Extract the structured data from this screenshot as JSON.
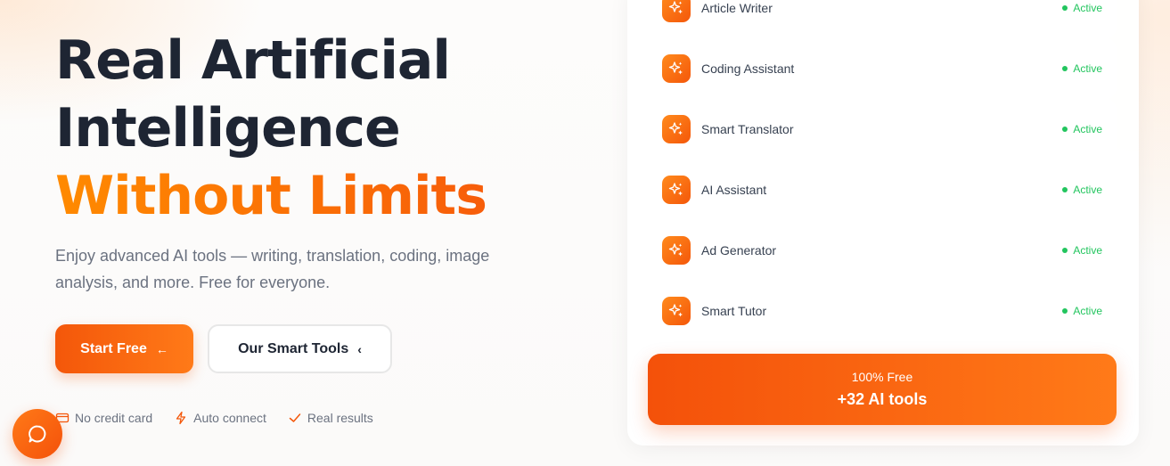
{
  "hero": {
    "title_line1": "Real Artificial",
    "title_line2": "Intelligence",
    "title_accent": "Without Limits",
    "subtitle": "Enjoy advanced AI tools — writing, translation, coding, image analysis, and more. Free for everyone."
  },
  "buttons": {
    "start_label": "Start Free",
    "start_arrow": "←",
    "tools_label": "Our Smart Tools",
    "tools_arrow": "‹"
  },
  "features": [
    {
      "label": "No credit card",
      "icon": "credit-card-icon"
    },
    {
      "label": "Auto connect",
      "icon": "lightning-icon"
    },
    {
      "label": "Real results",
      "icon": "check-icon"
    }
  ],
  "tools": [
    {
      "name": "Article Writer",
      "status": "Active"
    },
    {
      "name": "Coding Assistant",
      "status": "Active"
    },
    {
      "name": "Smart Translator",
      "status": "Active"
    },
    {
      "name": "AI Assistant",
      "status": "Active"
    },
    {
      "name": "Ad Generator",
      "status": "Active"
    },
    {
      "name": "Smart Tutor",
      "status": "Active"
    }
  ],
  "cta": {
    "small": "100% Free",
    "big": "+32 AI tools"
  },
  "colors": {
    "accent": "#f4570a",
    "accent_light": "#ff8a00",
    "heading": "#1e2533",
    "muted": "#6b7280",
    "active": "#22c55e"
  },
  "chat_icon": "chat-bubble-icon"
}
